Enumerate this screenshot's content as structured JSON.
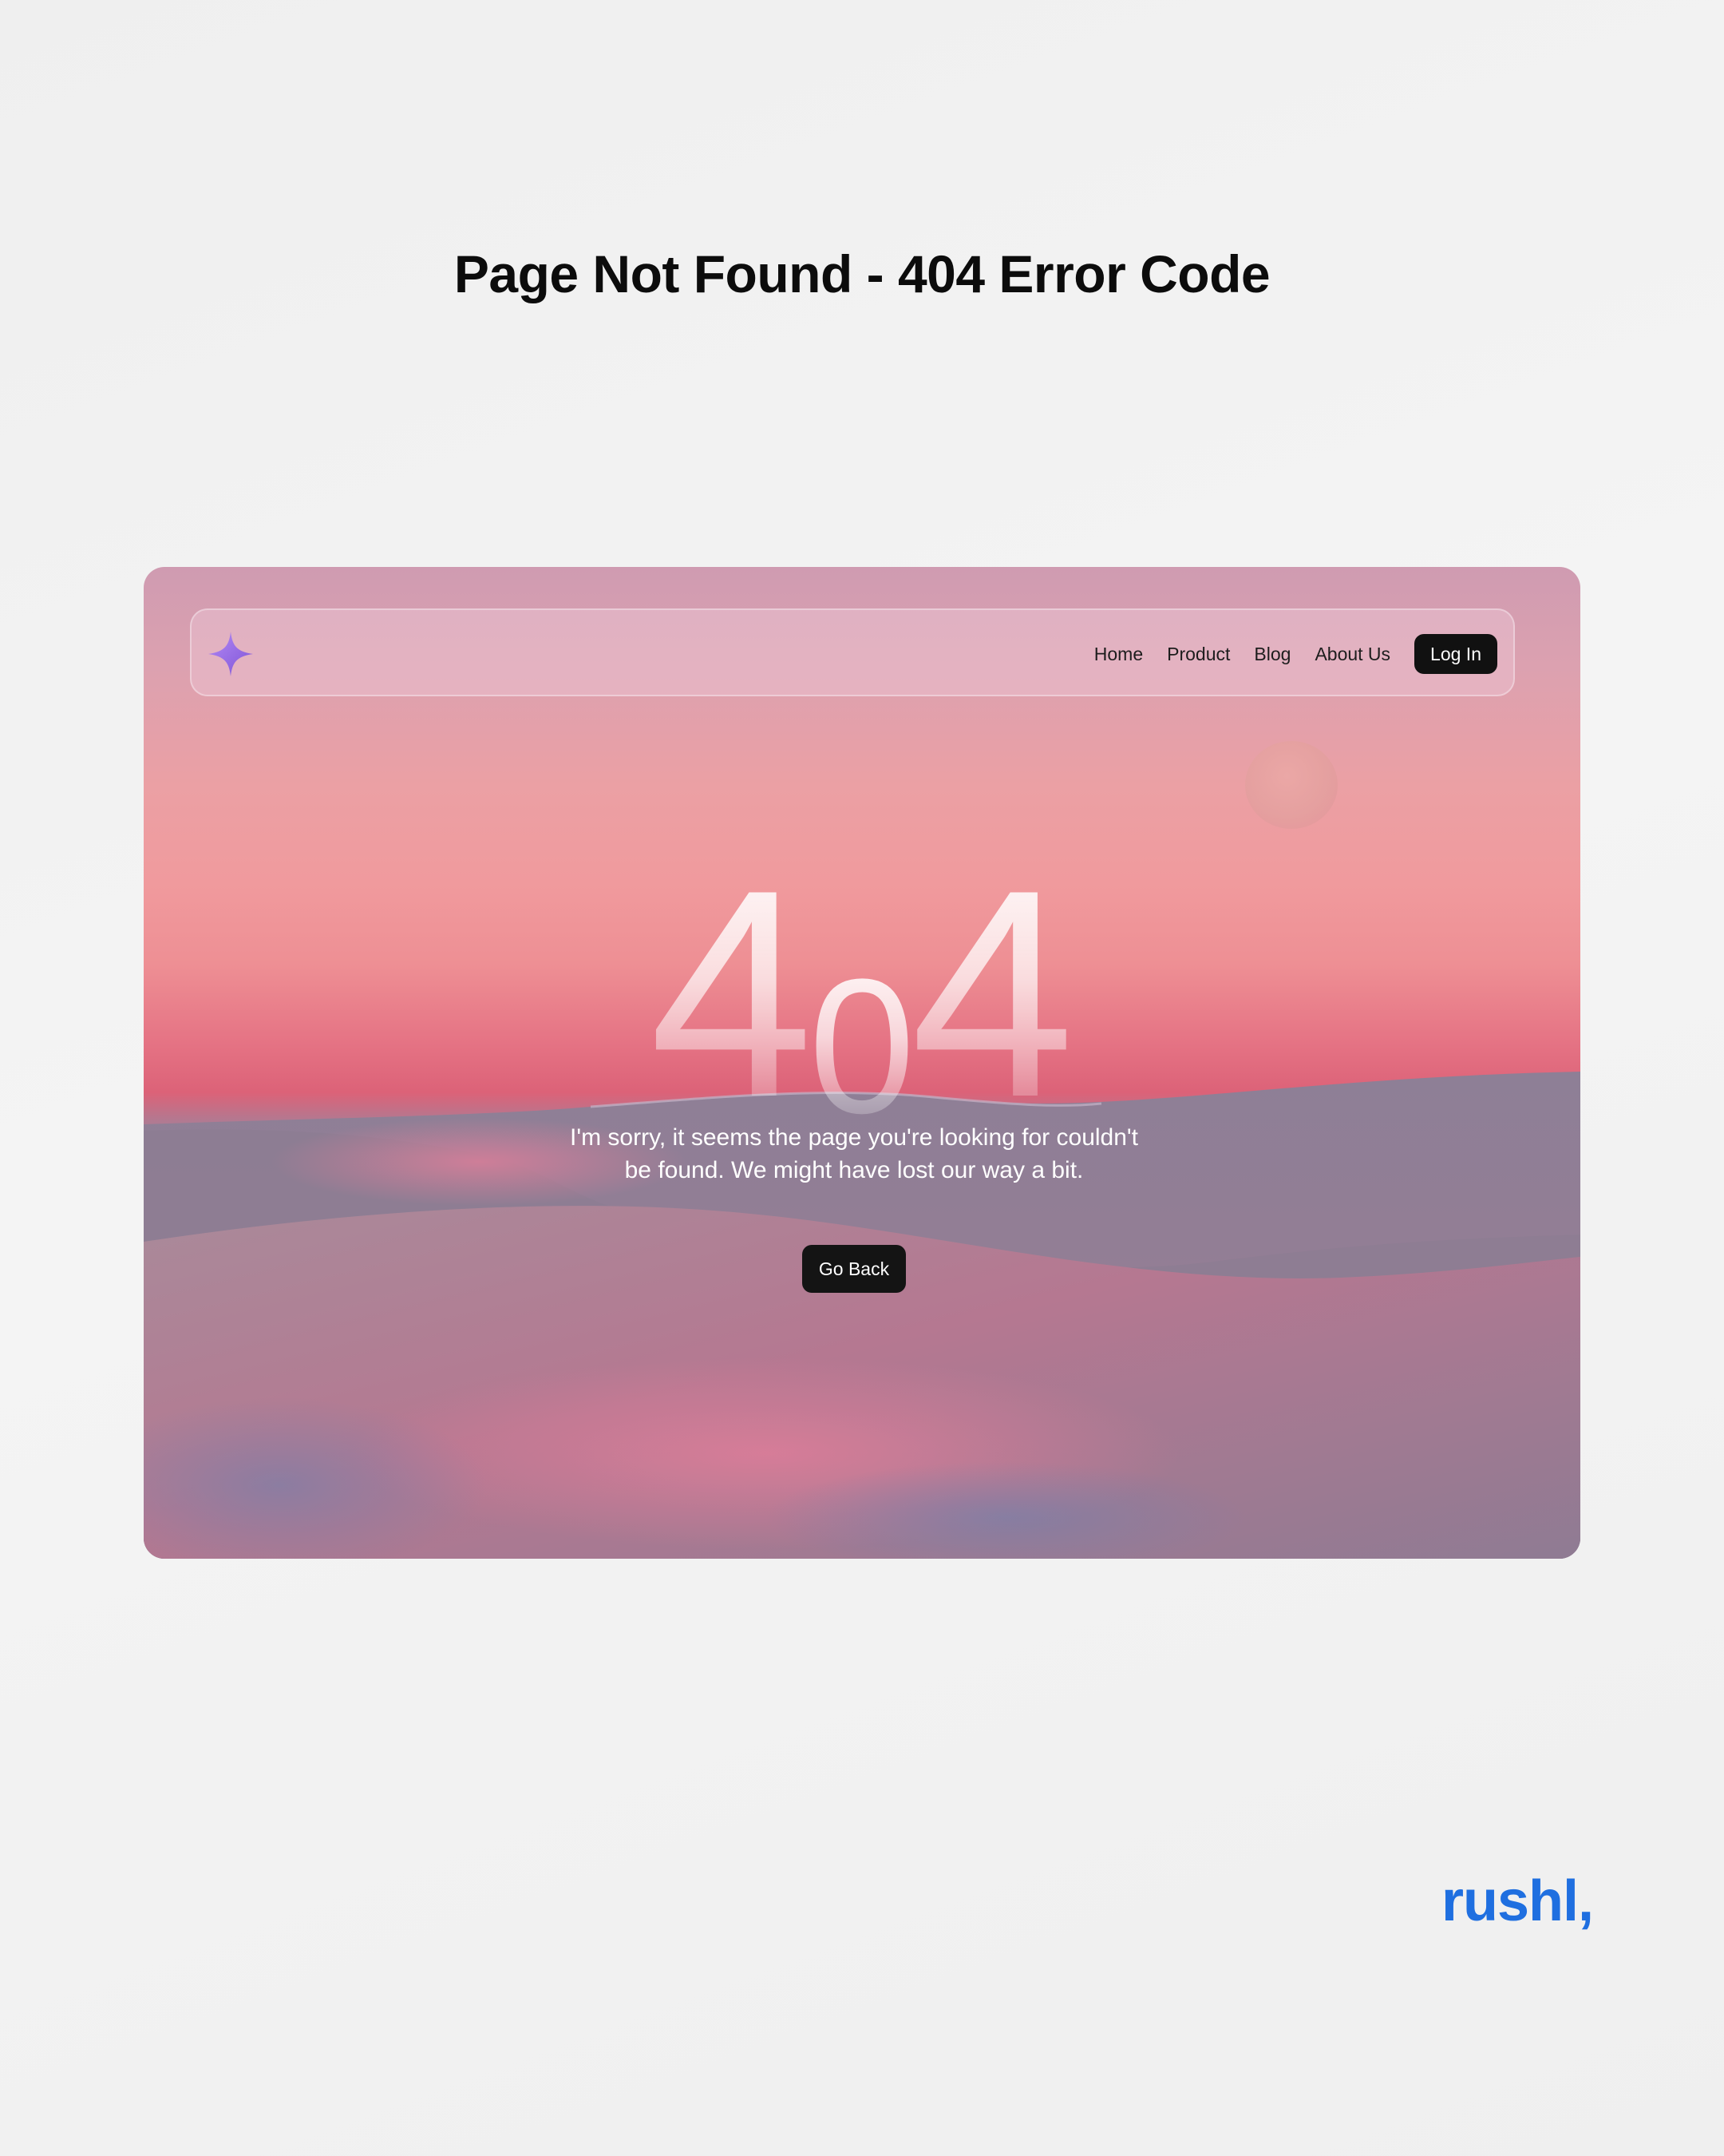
{
  "page": {
    "heading": "Page Not Found - 404 Error Code",
    "brand_signature": "rushl,"
  },
  "navbar": {
    "logo_icon": "sparkle-star-icon",
    "links": [
      "Home",
      "Product",
      "Blog",
      "About Us"
    ],
    "login_label": "Log In"
  },
  "error": {
    "code_digits": [
      "4",
      "0",
      "4"
    ],
    "message_line1": "I'm sorry, it seems the page you're looking for couldn't",
    "message_line2": "be found. We might have lost our way a bit.",
    "button_label": "Go Back"
  },
  "colors": {
    "brand": "#1f6fe0",
    "button": "#111111",
    "logo": "#9b6ee8",
    "sky_top": "#cf9bb1",
    "sky_horizon": "#dc6278",
    "dunes": "#8f7c92"
  }
}
